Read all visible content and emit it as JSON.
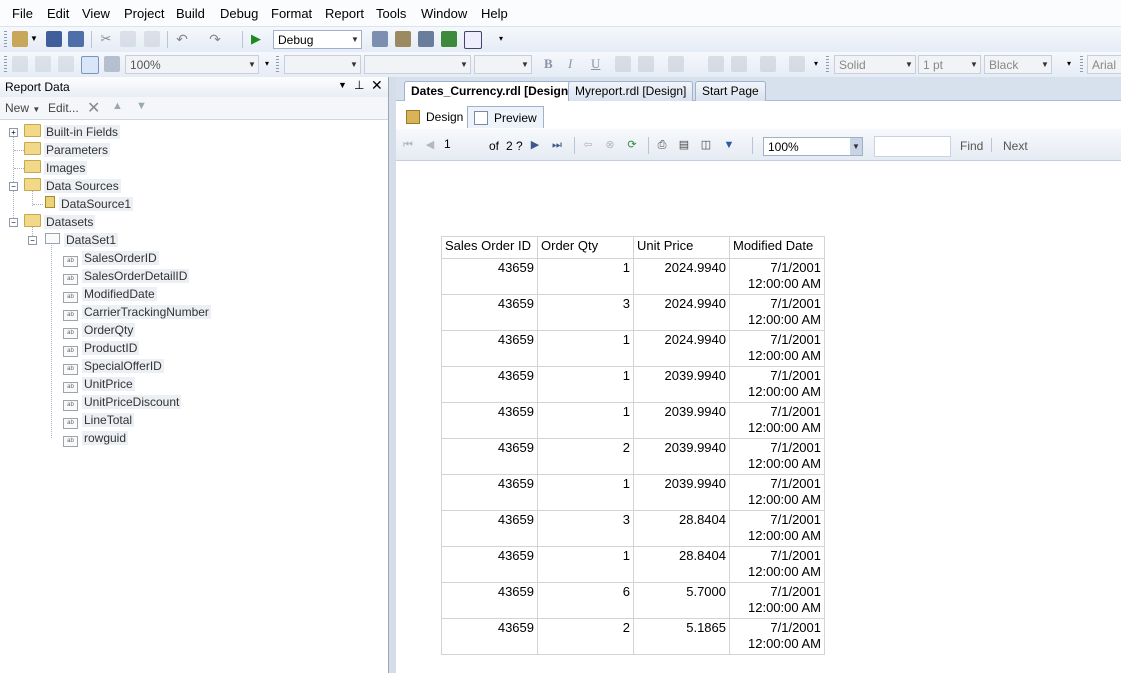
{
  "menu": [
    "File",
    "Edit",
    "View",
    "Project",
    "Build",
    "Debug",
    "Format",
    "Report",
    "Tools",
    "Window",
    "Help"
  ],
  "toolbar1": {
    "config": "Debug"
  },
  "toolbar2": {
    "zoom": "100%",
    "bold": "B",
    "italic": "I",
    "underline": "U",
    "border_style": "Solid",
    "border_width": "1 pt",
    "border_color": "Black",
    "font": "Arial"
  },
  "panel": {
    "title": "Report Data",
    "new_label": "New",
    "edit_label": "Edit...",
    "tree": {
      "builtin": "Built-in Fields",
      "parameters": "Parameters",
      "images": "Images",
      "datasources": "Data Sources",
      "datasource1": "DataSource1",
      "datasets": "Datasets",
      "dataset1": "DataSet1",
      "fields": [
        "SalesOrderID",
        "SalesOrderDetailID",
        "ModifiedDate",
        "CarrierTrackingNumber",
        "OrderQty",
        "ProductID",
        "SpecialOfferID",
        "UnitPrice",
        "UnitPriceDiscount",
        "LineTotal",
        "rowguid"
      ]
    }
  },
  "doc_tabs": [
    "Dates_Currency.rdl [Design]",
    "Myreport.rdl [Design]",
    "Start Page"
  ],
  "view_tabs": [
    "Design",
    "Preview"
  ],
  "viewer": {
    "page": "1",
    "of_label": "of",
    "total_pages": "2 ?",
    "zoom": "100%",
    "find_label": "Find",
    "next_label": "Next"
  },
  "report": {
    "headers": [
      "Sales Order ID",
      "Order Qty",
      "Unit Price",
      "Modified Date"
    ],
    "rows": [
      {
        "id": "43659",
        "qty": "1",
        "price": "2024.9940",
        "date1": "7/1/2001",
        "date2": "12:00:00 AM"
      },
      {
        "id": "43659",
        "qty": "3",
        "price": "2024.9940",
        "date1": "7/1/2001",
        "date2": "12:00:00 AM"
      },
      {
        "id": "43659",
        "qty": "1",
        "price": "2024.9940",
        "date1": "7/1/2001",
        "date2": "12:00:00 AM"
      },
      {
        "id": "43659",
        "qty": "1",
        "price": "2039.9940",
        "date1": "7/1/2001",
        "date2": "12:00:00 AM"
      },
      {
        "id": "43659",
        "qty": "1",
        "price": "2039.9940",
        "date1": "7/1/2001",
        "date2": "12:00:00 AM"
      },
      {
        "id": "43659",
        "qty": "2",
        "price": "2039.9940",
        "date1": "7/1/2001",
        "date2": "12:00:00 AM"
      },
      {
        "id": "43659",
        "qty": "1",
        "price": "2039.9940",
        "date1": "7/1/2001",
        "date2": "12:00:00 AM"
      },
      {
        "id": "43659",
        "qty": "3",
        "price": "28.8404",
        "date1": "7/1/2001",
        "date2": "12:00:00 AM"
      },
      {
        "id": "43659",
        "qty": "1",
        "price": "28.8404",
        "date1": "7/1/2001",
        "date2": "12:00:00 AM"
      },
      {
        "id": "43659",
        "qty": "6",
        "price": "5.7000",
        "date1": "7/1/2001",
        "date2": "12:00:00 AM"
      },
      {
        "id": "43659",
        "qty": "2",
        "price": "5.1865",
        "date1": "7/1/2001",
        "date2": "12:00:00 AM"
      }
    ]
  }
}
